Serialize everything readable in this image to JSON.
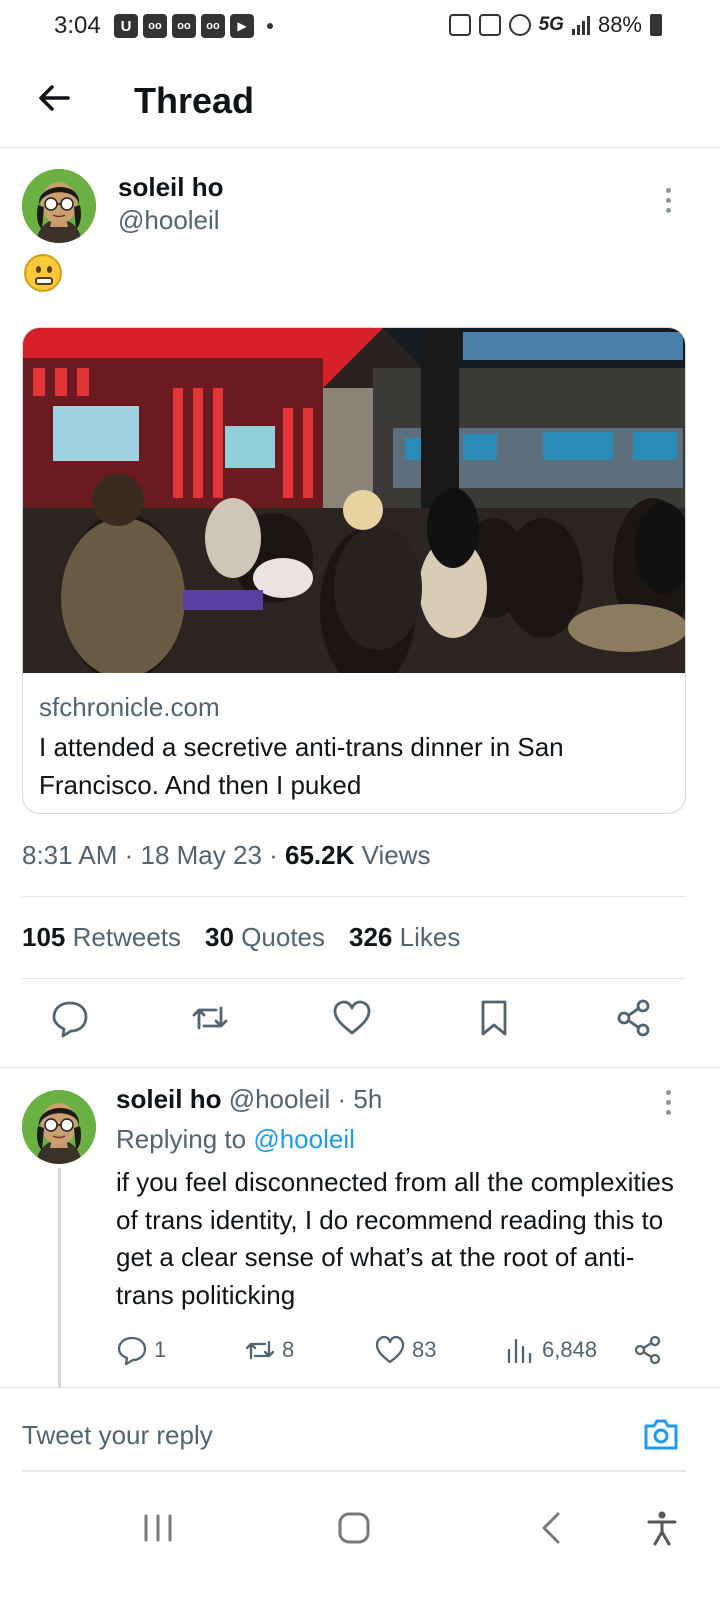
{
  "status_bar": {
    "time": "3:04",
    "notification_icons": [
      "U",
      "oo",
      "oo",
      "oo",
      "▶"
    ],
    "network": "5G",
    "battery": "88%"
  },
  "header": {
    "title": "Thread"
  },
  "main_tweet": {
    "name": "soleil ho",
    "handle": "@hooleil",
    "emoji": "grimacing-face",
    "card": {
      "domain": "sfchronicle.com",
      "title": "I attended a secretive anti-trans dinner in San Francisco. And then I puked"
    },
    "timestamp": "8:31 AM · 18 May 23 · ",
    "views_count": "65.2K",
    "views_label": " Views",
    "stats": {
      "retweets_count": "105",
      "retweets_label": "Retweets",
      "quotes_count": "30",
      "quotes_label": "Quotes",
      "likes_count": "326",
      "likes_label": "Likes"
    }
  },
  "reply_tweet": {
    "name": "soleil ho",
    "handle_time": "@hooleil · 5h",
    "replying_prefix": "Replying to ",
    "replying_to": "@hooleil",
    "text": "if you feel disconnected from all the complexities of trans identity, I do recommend reading this to get a clear sense of what’s at the root of anti-trans politicking",
    "replies": "1",
    "retweets": "8",
    "likes": "83",
    "views": "6,848"
  },
  "compose": {
    "placeholder": "Tweet your reply"
  },
  "colors": {
    "accent": "#1d9bf0",
    "secondary_text": "#536471",
    "primary_text": "#0f1419",
    "divider": "#e1e6ea"
  }
}
